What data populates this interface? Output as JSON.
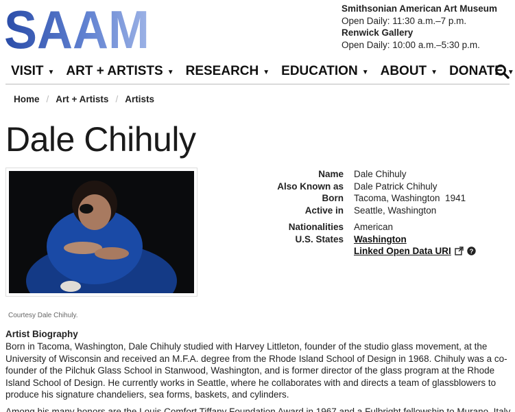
{
  "logo": {
    "text": "SAAM"
  },
  "hours": {
    "museum_name": "Smithsonian American Art Museum",
    "museum_hours": "Open Daily: 11:30 a.m.–7 p.m.",
    "gallery_name": "Renwick Gallery",
    "gallery_hours": "Open Daily: 10:00 a.m.–5:30 p.m."
  },
  "nav": {
    "items": [
      {
        "label": "VISIT"
      },
      {
        "label": "ART + ARTISTS"
      },
      {
        "label": "RESEARCH"
      },
      {
        "label": "EDUCATION"
      },
      {
        "label": "ABOUT"
      },
      {
        "label": "DONATE"
      }
    ],
    "search_icon": "search-icon"
  },
  "breadcrumb": [
    "Home",
    "Art + Artists",
    "Artists"
  ],
  "title": "Dale Chihuly",
  "photo_credit": "Courtesy Dale Chihuly.",
  "facts": {
    "name_label": "Name",
    "name": "Dale Chihuly",
    "aka_label": "Also Known as",
    "aka": "Dale Patrick Chihuly",
    "born_label": "Born",
    "born": "Tacoma, Washington  1941",
    "active_label": "Active in",
    "active": "Seattle, Washington",
    "nationalities_label": "Nationalities",
    "nationalities": "American",
    "states_label": "U.S. States",
    "states": "Washington",
    "lod": "Linked Open Data URI"
  },
  "bio": {
    "heading": "Artist Biography",
    "paragraph1": "Born in Tacoma, Washington, Dale Chihuly studied with Harvey Littleton, founder of the studio glass movement, at the University of Wisconsin and received an M.F.A. degree from the Rhode Island School of Design in 1968. Chihuly was a co-founder of the Pilchuk Glass School in Stanwood, Washington, and is former director of the glass program at the Rhode Island School of Design. He currently works in Seattle, where he collaborates with and directs a team of glassblowers to produce his signature chandeliers, sea forms, baskets, and cylinders.",
    "paragraph2": "Among his many honors are the Louis Comfort Tiffany Foundation Award in 1967 and a Fulbright fellowship to Murano, Italy, in"
  },
  "colors": {
    "logo_dark": "#2a4ca8",
    "logo_light": "#8fa8e0"
  }
}
